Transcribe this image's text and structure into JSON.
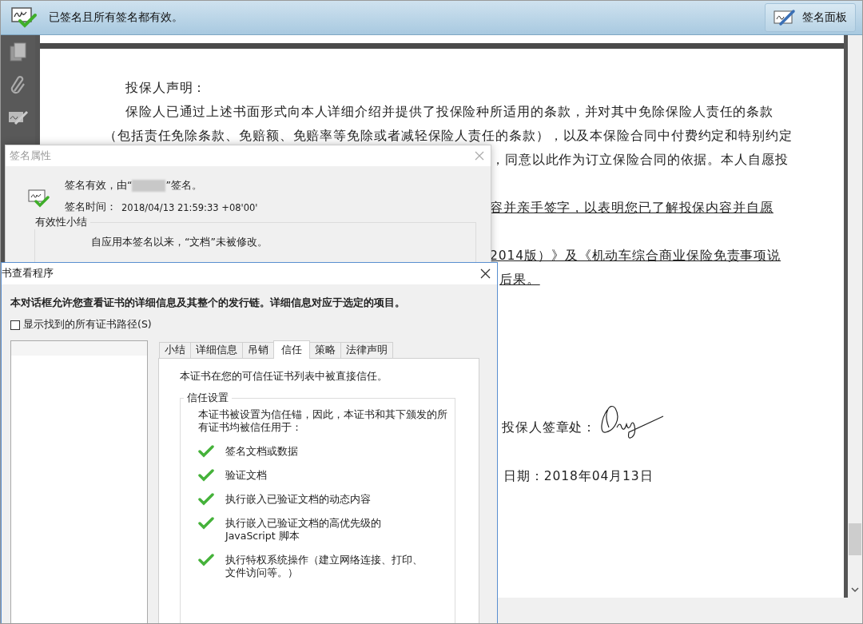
{
  "status_bar": {
    "message": "已签名且所有签名都有效。",
    "signature_panel_button": "签名面板"
  },
  "document": {
    "lines": [
      {
        "text": "投保人声明：",
        "underlined": false
      },
      {
        "text": "保险人已通过上述书面形式向本人详细介绍并提供了投保险种所适用的条款，并对其中免除保险人责任的条款",
        "underlined": false
      },
      {
        "text": "（包括责任免除条款、免赔额、免赔率等免除或者减轻保险人责任的条款），以及本保险合同中付费约定和特别约定",
        "underlined": false
      },
      {
        "text": "，同意以此作为订立保险合同的依据。本人自愿投",
        "underlined": false
      },
      {
        "text": "容并亲手签字，以表明您已了解投保内容并自愿",
        "underlined": true
      },
      {
        "text": "2014版）》及《机动车综合商业保险免责事项说",
        "underlined": true
      },
      {
        "text": "后果。",
        "underlined": true
      }
    ],
    "signature_label": "投保人签章处：",
    "date": "日期：2018年04月13日"
  },
  "signature_properties": {
    "title": "签名属性",
    "status_prefix": "签名有效，由“",
    "status_suffix": "”签名。",
    "time_label": "签名时间：",
    "time": "2018/04/13 21:59:33 +08'00'",
    "summary_group": "有效性小结",
    "summary": "自应用本签名以来，“文档”未被修改。"
  },
  "certificate_viewer": {
    "title": "书查看程序",
    "description": "本对话框允许您查看证书的详细信息及其整个的发行链。详细信息对应于选定的项目。",
    "show_all_paths": {
      "label": "显示找到的所有证书路径(S)",
      "checked": false
    },
    "tabs": [
      {
        "label": "小结",
        "selected": false
      },
      {
        "label": "详细信息",
        "selected": false
      },
      {
        "label": "吊销",
        "selected": false
      },
      {
        "label": "信任",
        "selected": true
      },
      {
        "label": "策略",
        "selected": false
      },
      {
        "label": "法律声明",
        "selected": false
      }
    ],
    "trust_statement": "本证书在您的可信任证书列表中被直接信任。",
    "trust_settings": {
      "title": "信任设置",
      "intro": "本证书被设置为信任锚，因此，本证书和其下颁发的所有证书均被信任用于：",
      "permissions": [
        {
          "text": "签名文档或数据",
          "allowed": true
        },
        {
          "text": "验证文档",
          "allowed": true
        },
        {
          "text": "执行嵌入已验证文档的动态内容",
          "allowed": true
        },
        {
          "text": "执行嵌入已验证文档的高优先级的JavaScript 脚本",
          "allowed": true
        },
        {
          "text": "执行特权系统操作（建立网络连接、打印、文件访问等。）",
          "allowed": true
        }
      ]
    }
  }
}
